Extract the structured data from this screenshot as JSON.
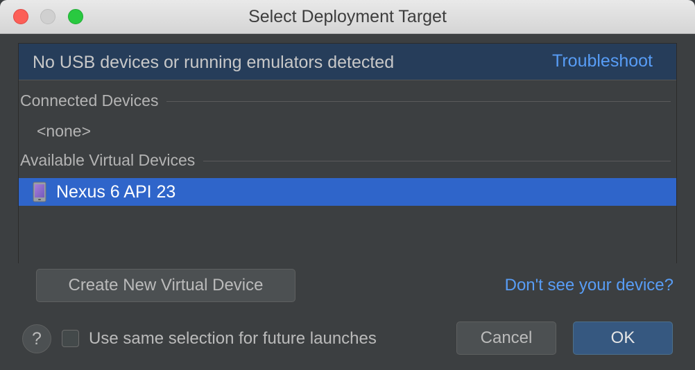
{
  "window": {
    "title": "Select Deployment Target"
  },
  "banner": {
    "message": "No USB devices or running emulators detected",
    "link_label": "Troubleshoot"
  },
  "list": {
    "connected_header": "Connected Devices",
    "connected_empty": "<none>",
    "virtual_header": "Available Virtual Devices",
    "virtual_devices": [
      {
        "name": "Nexus 6 API 23",
        "icon": "phone-icon",
        "selected": true
      }
    ]
  },
  "actions": {
    "create_label": "Create New Virtual Device",
    "help_link": "Don't see your device?"
  },
  "footer": {
    "help_symbol": "?",
    "checkbox_label": "Use same selection for future launches",
    "checkbox_checked": false,
    "cancel_label": "Cancel",
    "ok_label": "OK"
  },
  "colors": {
    "background": "#3c3f41",
    "banner": "#263d5a",
    "link": "#589df6",
    "selection": "#2f65ca",
    "ok_button": "#365880"
  }
}
